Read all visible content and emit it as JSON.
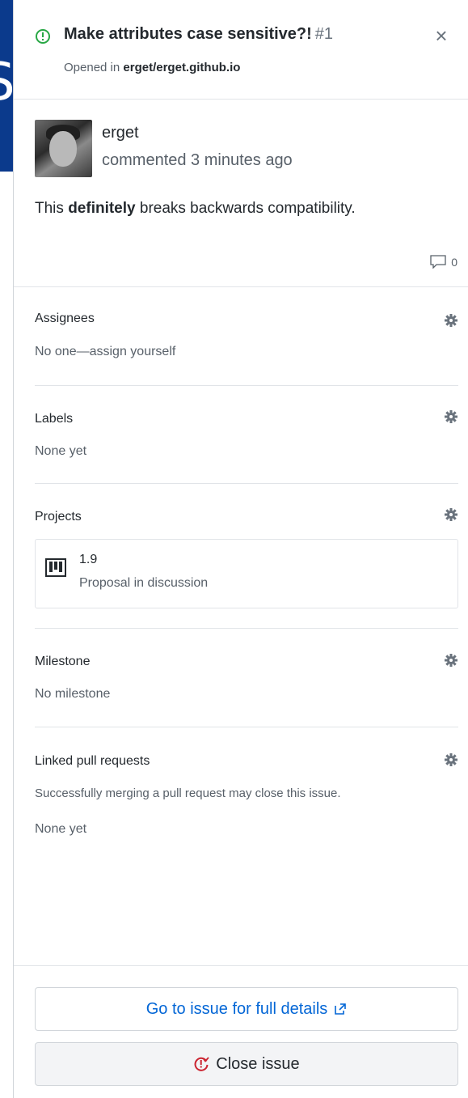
{
  "colors": {
    "link": "#0366d6",
    "open_green": "#28a745",
    "close_red": "#cb2431",
    "left_accent": "#0b3a8c"
  },
  "left_edge": {
    "glyph": "S"
  },
  "issue": {
    "title": "Make attributes case sensitive?!",
    "number": "#1",
    "opened_prefix": "Opened in",
    "repo": "erget/erget.github.io",
    "close_label": "×"
  },
  "comment": {
    "author": "erget",
    "time": "commented 3 minutes ago",
    "body_before": "This ",
    "body_bold": "definitely",
    "body_after": " breaks backwards compatibility.",
    "reply_count": "0"
  },
  "sidebar": {
    "assignees": {
      "title": "Assignees",
      "value": "No one—assign yourself"
    },
    "labels": {
      "title": "Labels",
      "value": "None yet"
    },
    "projects": {
      "title": "Projects",
      "project_name": "1.9",
      "project_column": "Proposal in discussion"
    },
    "milestone": {
      "title": "Milestone",
      "value": "No milestone"
    },
    "linked_prs": {
      "title": "Linked pull requests",
      "hint": "Successfully merging a pull request may close this issue.",
      "value": "None yet"
    }
  },
  "footer": {
    "goto_label": "Go to issue for full details",
    "close_issue_label": "Close issue"
  }
}
